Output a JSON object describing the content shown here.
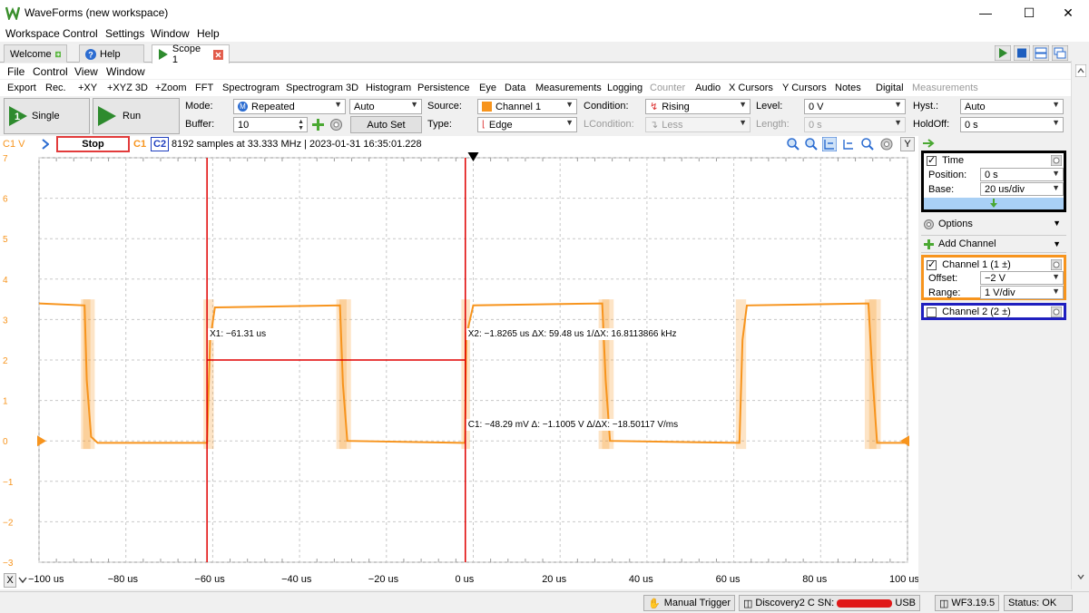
{
  "app": {
    "title": "WaveForms (new workspace)",
    "accent": "#f7941d",
    "logo": "waveforms-logo"
  },
  "main_menu": [
    "Workspace",
    "Control",
    "Settings",
    "Window",
    "Help"
  ],
  "tabs": [
    {
      "label": "Welcome",
      "icon": "plus-icon"
    },
    {
      "label": "Help",
      "icon": "help-icon"
    },
    {
      "label": "Scope 1",
      "icon": "play-icon",
      "active": true
    }
  ],
  "sub_menu": [
    "File",
    "Control",
    "View",
    "Window"
  ],
  "toolbar": {
    "items": [
      "Export",
      "Rec.",
      "+XY",
      "+XYZ 3D",
      "+Zoom",
      "FFT",
      "Spectrogram",
      "Spectrogram 3D",
      "Histogram",
      "Persistence",
      "Eye",
      "Data",
      "Measurements",
      "Logging",
      "Counter",
      "Audio",
      "X Cursors",
      "Y Cursors",
      "Notes",
      "Digital",
      "Measurements"
    ],
    "disabled": [
      "Counter",
      "Measurements"
    ]
  },
  "controls": {
    "single": "Single",
    "single_key": "1",
    "run": "Run",
    "mode_label": "Mode:",
    "mode_value": "Repeated",
    "mode_badge": "M",
    "mode_auto": "Auto",
    "buffer_label": "Buffer:",
    "buffer_value": "10",
    "auto_set": "Auto Set",
    "source_label": "Source:",
    "source_value": "Channel 1",
    "type_label": "Type:",
    "type_value": "Edge",
    "condition_label": "Condition:",
    "condition_value": "Rising",
    "lcondition_label": "LCondition:",
    "lcondition_value": "Less",
    "level_label": "Level:",
    "level_value": "0 V",
    "length_label": "Length:",
    "length_value": "0 s",
    "hyst_label": "Hyst.:",
    "hyst_value": "Auto",
    "holdoff_label": "HoldOff:",
    "holdoff_value": "0 s"
  },
  "status_line": {
    "channel_units": "C1  V",
    "state": "Stop",
    "c1": "C1",
    "c2": "C2",
    "info": "8192 samples at 33.333 MHz | 2023-01-31 16:35:01.228",
    "y_button": "Y"
  },
  "plot": {
    "y_ticks": [
      "7",
      "6",
      "5",
      "4",
      "3",
      "2",
      "1",
      "0",
      "−1",
      "−2",
      "−3"
    ],
    "x_ticks": [
      "−100 us",
      "−80 us",
      "−60 us",
      "−40 us",
      "−20 us",
      "0 us",
      "20 us",
      "40 us",
      "60 us",
      "80 us",
      "100 us"
    ],
    "x_axis_button": "X",
    "cursor_x1": "X1: −61.31 us",
    "cursor_x2": "X2: −1.8265 us   ΔX: 59.48 us     1/ΔX: 16.8113866 kHz",
    "cursor_y": "C1: −48.29 mV     Δ: −1.1005 V       Δ/ΔX: −18.50117 V/ms",
    "waveform_color": "#f7941d",
    "cursor_color": "#e00000"
  },
  "chart_data": {
    "type": "line",
    "title": "",
    "xlabel": "",
    "ylabel": "V",
    "xlim": [
      -100,
      100
    ],
    "ylim": [
      -3,
      7
    ],
    "series": [
      {
        "name": "Channel 1",
        "x": [
          -100,
          -89.5,
          -89,
          -88,
          -86.5,
          -61.3,
          -60.6,
          -59.5,
          -30.7,
          -30,
          -29,
          -1.9,
          -1.6,
          0,
          29.7,
          30.5,
          31.5,
          61.3,
          62,
          63,
          91,
          92,
          93,
          100
        ],
        "y": [
          3.4,
          3.35,
          1.5,
          0.1,
          -0.05,
          -0.05,
          2.5,
          3.3,
          3.35,
          1.4,
          0.0,
          -0.05,
          2.6,
          3.35,
          3.4,
          1.5,
          0.0,
          -0.05,
          2.5,
          3.35,
          3.4,
          1.5,
          -0.05,
          -0.05
        ]
      }
    ],
    "cursors": {
      "x1": -61.31,
      "x2": -1.8265,
      "y_level": 2.0
    }
  },
  "right_panel": {
    "time_title": "Time",
    "position_label": "Position:",
    "position_value": "0 s",
    "base_label": "Base:",
    "base_value": "20 us/div",
    "options": "Options",
    "add_channel": "Add Channel",
    "channel1_title": "Channel 1 (1 ±)",
    "offset_label": "Offset:",
    "offset_value": "−2 V",
    "range_label": "Range:",
    "range_value": "1 V/div",
    "channel2_title": "Channel 2 (2 ±)"
  },
  "bottom_bar": {
    "manual_trigger": "Manual Trigger",
    "device": "Discovery2 C SN:",
    "usb": "USB",
    "version": "WF3.19.5",
    "status": "Status: OK"
  }
}
